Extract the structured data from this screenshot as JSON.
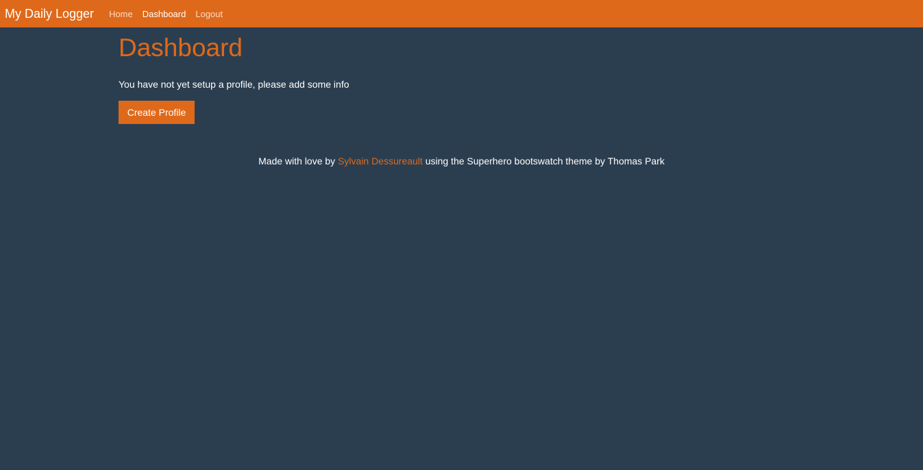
{
  "colors": {
    "background": "#2b3e50",
    "accent": "#df691a",
    "text": "#ffffff"
  },
  "navbar": {
    "brand": "My Daily Logger",
    "links": [
      {
        "label": "Home",
        "active": false
      },
      {
        "label": "Dashboard",
        "active": true
      },
      {
        "label": "Logout",
        "active": false
      }
    ]
  },
  "main": {
    "title": "Dashboard",
    "message": "You have not yet setup a profile, please add some info",
    "create_profile_label": "Create Profile"
  },
  "footer": {
    "prefix": "Made with love by ",
    "author_link": "Sylvain Dessureault",
    "suffix": " using the Superhero bootswatch theme by Thomas Park"
  }
}
